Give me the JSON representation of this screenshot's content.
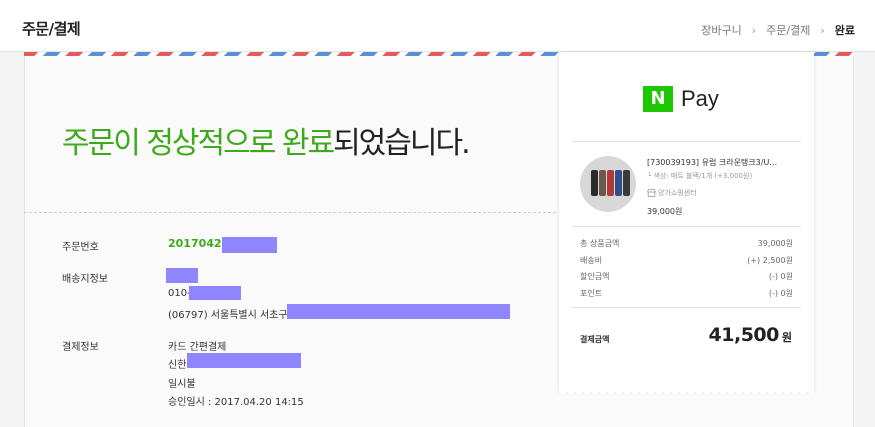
{
  "header": {
    "title": "주문/결제",
    "breadcrumb": [
      {
        "label": "장바구니"
      },
      {
        "label": "주문/결제"
      },
      {
        "label": "완료"
      }
    ],
    "separator": "›"
  },
  "main": {
    "headline_green": "주문이 정상적으로 완료",
    "headline_rest": "되었습니다.",
    "order_number": {
      "label": "주문번호",
      "value": "20170420"
    },
    "shipping": {
      "label": "배송지정보",
      "phone_prefix": "010-",
      "address_prefix": "(06797) 서울특별시 서초구"
    },
    "payment": {
      "label": "결제정보",
      "method": "카드 간편결제",
      "card_prefix": "신한",
      "installment": "일시불",
      "approval": "승인일시 : 2017.04.20 14:15"
    }
  },
  "receipt": {
    "brand_letter": "N",
    "brand_text": "Pay",
    "product": {
      "name": "[730039193] 유럽 크라운탱크3/U…",
      "option": "└ 색상: 매트 블랙/1개 (+3,000원)",
      "store": "양가쇼핑센터",
      "price": "39,000원"
    },
    "summary": [
      {
        "label": "총 상품금액",
        "value": "39,000원"
      },
      {
        "label": "배송비",
        "value": "(+) 2,500원"
      },
      {
        "label": "할인금액",
        "value": "(-) 0원"
      },
      {
        "label": "포인트",
        "value": "(-) 0원"
      }
    ],
    "total": {
      "label": "결제금액",
      "amount": "41,500",
      "unit": "원"
    }
  },
  "colors": {
    "accent_green": "#3daa1b",
    "npay_green": "#1ec800",
    "redaction": "#8f85ff",
    "airmail_red": "#e55a5a",
    "airmail_blue": "#5a8fd6"
  },
  "icons": [
    "chevron-right-icon",
    "store-icon",
    "npay-logo"
  ]
}
